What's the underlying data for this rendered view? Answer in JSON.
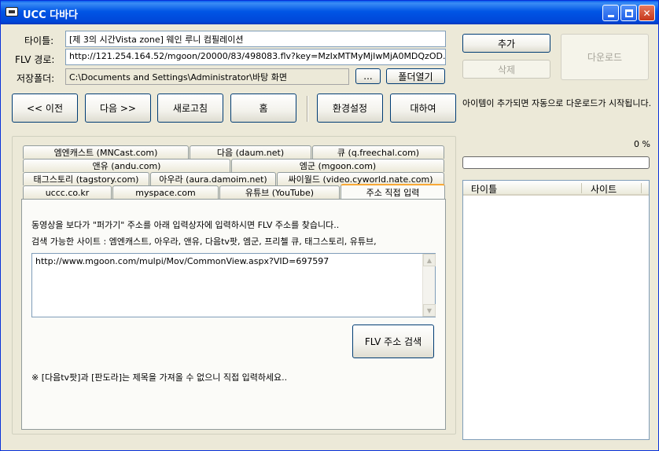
{
  "window": {
    "title": "UCC 다바다"
  },
  "fields": {
    "title_label": "타이틀:",
    "title_value": "[제 3의 시간Vista zone] 웨인 루니 컴필레이션",
    "flv_label": "FLV 경로:",
    "flv_value": "http://121.254.164.52/mgoon/20000/83/498083.flv?key=MzIxMTMyMjIwMjA0MDQzOD.",
    "folder_label": "저장폴더:",
    "folder_value": "C:\\Documents and Settings\\Administrator\\바탕 화면"
  },
  "buttons": {
    "add": "추가",
    "delete": "삭제",
    "download": "다운로드",
    "browse": "...",
    "open_folder": "폴더열기",
    "prev": "<< 이전",
    "next": "다음 >>",
    "refresh": "새로고침",
    "home": "홈",
    "settings": "환경설정",
    "about": "대하여",
    "flv_search": "FLV 주소 검색"
  },
  "info_text": "아이템이 추가되면 자동으로 다운로드가 시작됩니다.",
  "tabs": [
    {
      "label": "엠엔캐스트 (MNCast.com)"
    },
    {
      "label": "다음 (daum.net)"
    },
    {
      "label": "큐 (q.freechal.com)"
    },
    {
      "label": "앤유 (andu.com)"
    },
    {
      "label": "엠군 (mgoon.com)"
    },
    {
      "label": "태그스토리 (tagstory.com)"
    },
    {
      "label": "아우라 (aura.damoim.net)"
    },
    {
      "label": "싸이월드 (video.cyworld.nate.com)"
    },
    {
      "label": "uccc.co.kr"
    },
    {
      "label": "myspace.com"
    },
    {
      "label": "유튜브 (YouTube)"
    },
    {
      "label": "주소 직접 입력"
    }
  ],
  "panel": {
    "instruction": "동영상을 보다가 \"퍼가기\" 주소를 아래 입력상자에 입력하시면 FLV 주소를 찾습니다..",
    "sites": "검색 가능한 사이트 : 엠엔캐스트, 아우라, 앤유, 다음tv팟, 엠군, 프리첼 큐, 태그스토리, 유튜브,",
    "url_value": "http://www.mgoon.com/mulpi/Mov/CommonView.aspx?VID=697597",
    "note": "※ [다음tv팟]과 [판도라]는 제목을 가져올 수 없으니 직접 입력하세요.."
  },
  "progress": {
    "percent_text": "0 %",
    "value": 0
  },
  "list": {
    "columns": [
      "타이틀",
      "사이트"
    ]
  },
  "colors": {
    "titlebar": "#0055e5",
    "window_bg": "#ece9d8",
    "active_tab_accent": "#f9a936"
  },
  "icons": {
    "app": "video-cassette-icon",
    "minimize": "minimize-icon",
    "maximize": "maximize-icon",
    "close": "close-icon"
  }
}
